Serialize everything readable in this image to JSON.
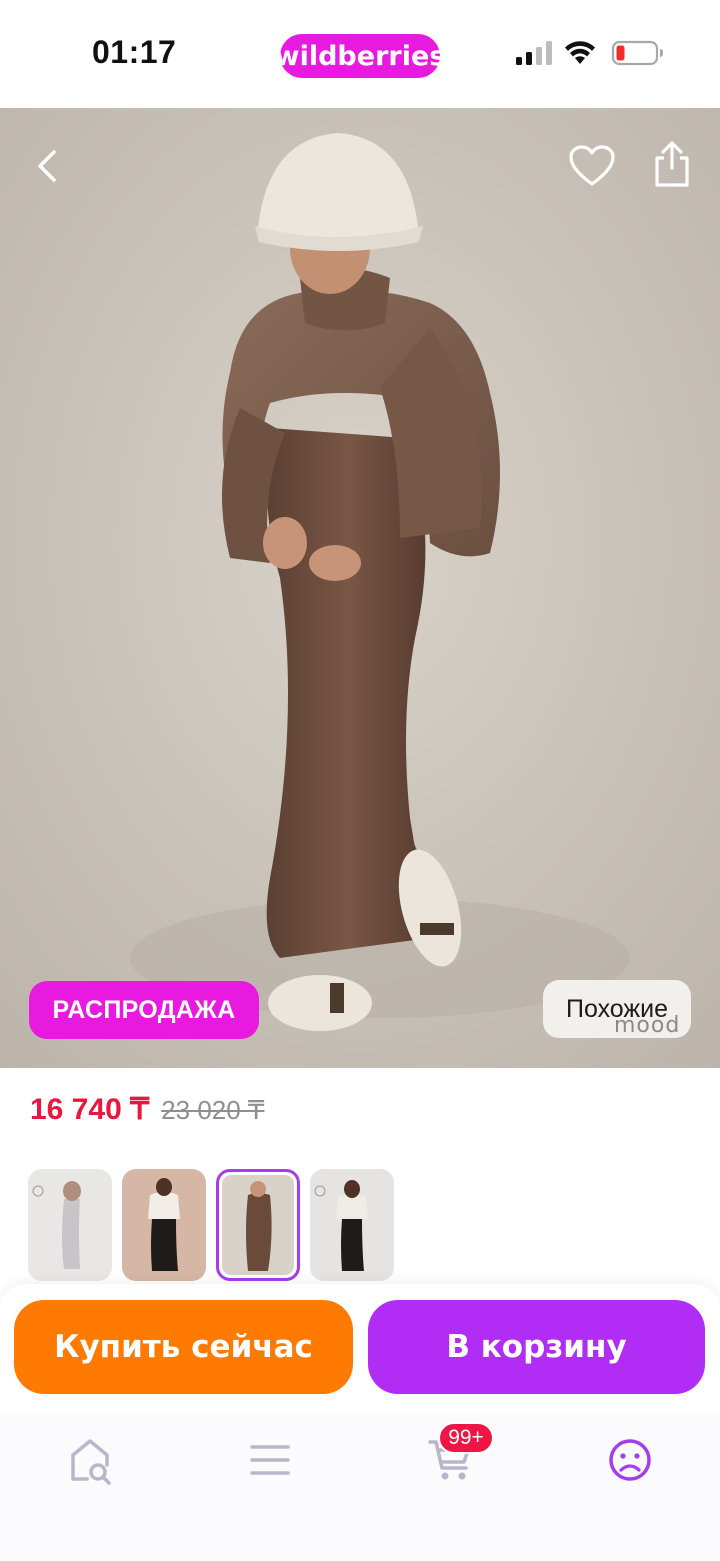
{
  "status_bar": {
    "time": "01:17",
    "brand": "wildberries"
  },
  "product": {
    "sale_badge": "РАСПРОДАЖА",
    "similar_label": "Похожие",
    "watermark": "mood",
    "price_current": "16 740 ₸",
    "price_old": "23 020 ₸",
    "thumbnails": [
      {
        "name": "light-grey-skirt"
      },
      {
        "name": "black-skirt-white-top"
      },
      {
        "name": "brown-skirt",
        "selected": true
      },
      {
        "name": "black-skirt-grey-top"
      }
    ]
  },
  "actions": {
    "buy_now": "Купить сейчас",
    "to_cart": "В корзину"
  },
  "tab_bar": {
    "items": [
      {
        "icon": "home-search-icon"
      },
      {
        "icon": "menu-icon"
      },
      {
        "icon": "cart-icon",
        "badge": "99+"
      },
      {
        "icon": "profile-icon",
        "active": true
      }
    ]
  },
  "colors": {
    "brand": "#e91ae0",
    "price": "#e8173f",
    "buy_now": "#ff7a00",
    "to_cart": "#b12cf5",
    "active_tab": "#a53cf0",
    "inactive_tab": "#b9b6cc"
  }
}
